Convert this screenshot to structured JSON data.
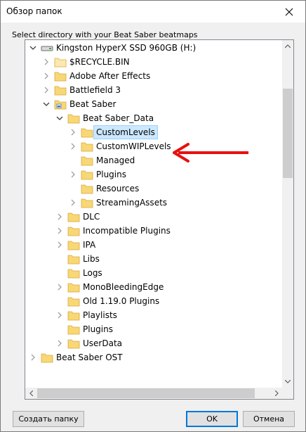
{
  "window": {
    "title": "Обзор папок",
    "instruction": "Select directory with your Beat Saber beatmaps"
  },
  "tree": {
    "items": [
      {
        "label": "Kingston HyperX SSD 960GB (H:)",
        "icon": "drive-icon",
        "expander": "expanded"
      },
      {
        "label": "$RECYCLE.BIN",
        "icon": "folder-icon-pale",
        "expander": "collapsed"
      },
      {
        "label": "Adobe After Effects",
        "icon": "folder-icon",
        "expander": "collapsed"
      },
      {
        "label": "Battlefield 3",
        "icon": "folder-icon",
        "expander": "collapsed"
      },
      {
        "label": "Beat Saber",
        "icon": "app-folder-icon",
        "expander": "expanded"
      },
      {
        "label": "Beat Saber_Data",
        "icon": "folder-icon",
        "expander": "expanded"
      },
      {
        "label": "CustomLevels",
        "icon": "folder-icon",
        "expander": "collapsed",
        "selected": true
      },
      {
        "label": "CustomWIPLevels",
        "icon": "folder-icon",
        "expander": "collapsed"
      },
      {
        "label": "Managed",
        "icon": "folder-icon",
        "expander": "none"
      },
      {
        "label": "Plugins",
        "icon": "folder-icon",
        "expander": "collapsed"
      },
      {
        "label": "Resources",
        "icon": "folder-icon",
        "expander": "none"
      },
      {
        "label": "StreamingAssets",
        "icon": "folder-icon",
        "expander": "collapsed"
      },
      {
        "label": "DLC",
        "icon": "folder-icon",
        "expander": "collapsed"
      },
      {
        "label": "Incompatible Plugins",
        "icon": "folder-icon",
        "expander": "collapsed"
      },
      {
        "label": "IPA",
        "icon": "folder-icon",
        "expander": "collapsed"
      },
      {
        "label": "Libs",
        "icon": "folder-icon",
        "expander": "none"
      },
      {
        "label": "Logs",
        "icon": "folder-icon",
        "expander": "none"
      },
      {
        "label": "MonoBleedingEdge",
        "icon": "folder-icon",
        "expander": "collapsed"
      },
      {
        "label": "Old 1.19.0 Plugins",
        "icon": "folder-icon",
        "expander": "none"
      },
      {
        "label": "Playlists",
        "icon": "folder-icon",
        "expander": "collapsed"
      },
      {
        "label": "Plugins",
        "icon": "folder-icon",
        "expander": "none"
      },
      {
        "label": "UserData",
        "icon": "folder-icon",
        "expander": "collapsed"
      },
      {
        "label": "Beat Saber OST",
        "icon": "folder-icon",
        "expander": "collapsed"
      }
    ]
  },
  "buttons": {
    "new_folder": "Создать папку",
    "ok": "OK",
    "cancel": "Отмена"
  },
  "colors": {
    "folder": "#f8d775",
    "selection": "#cce8ff",
    "annotation_arrow": "#e81010",
    "default_button_border": "#0078d7"
  }
}
